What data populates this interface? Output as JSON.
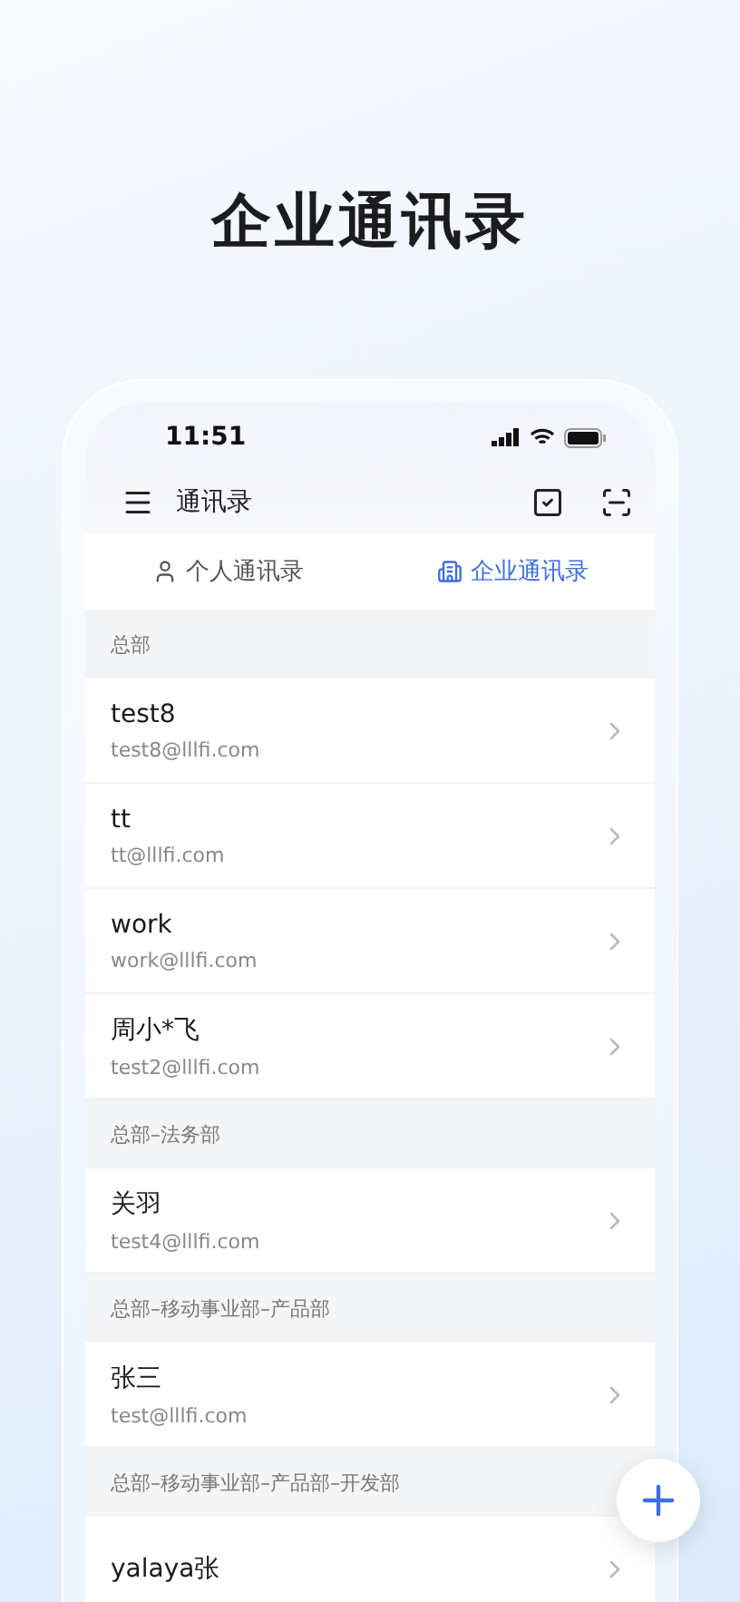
{
  "headline": "企业通讯录",
  "status_bar": {
    "time": "11:51"
  },
  "header": {
    "title": "通讯录"
  },
  "tabs": [
    {
      "label": "个人通讯录",
      "kind": "person",
      "selected": false
    },
    {
      "label": "企业通讯录",
      "kind": "building",
      "selected": true
    }
  ],
  "sections": [
    {
      "title": "总部",
      "contacts": [
        {
          "name": "test8",
          "email": "test8@lllfi.com"
        },
        {
          "name": "tt",
          "email": "tt@lllfi.com"
        },
        {
          "name": "work",
          "email": "work@lllfi.com"
        },
        {
          "name": "周小*飞",
          "email": "test2@lllfi.com"
        }
      ]
    },
    {
      "title": "总部–法务部",
      "contacts": [
        {
          "name": "关羽",
          "email": "test4@lllfi.com"
        }
      ]
    },
    {
      "title": "总部–移动事业部–产品部",
      "contacts": [
        {
          "name": "张三",
          "email": "test@lllfi.com"
        }
      ]
    },
    {
      "title": "总部–移动事业部–产品部–开发部",
      "contacts": [
        {
          "name": "yalaya张"
        }
      ]
    }
  ]
}
